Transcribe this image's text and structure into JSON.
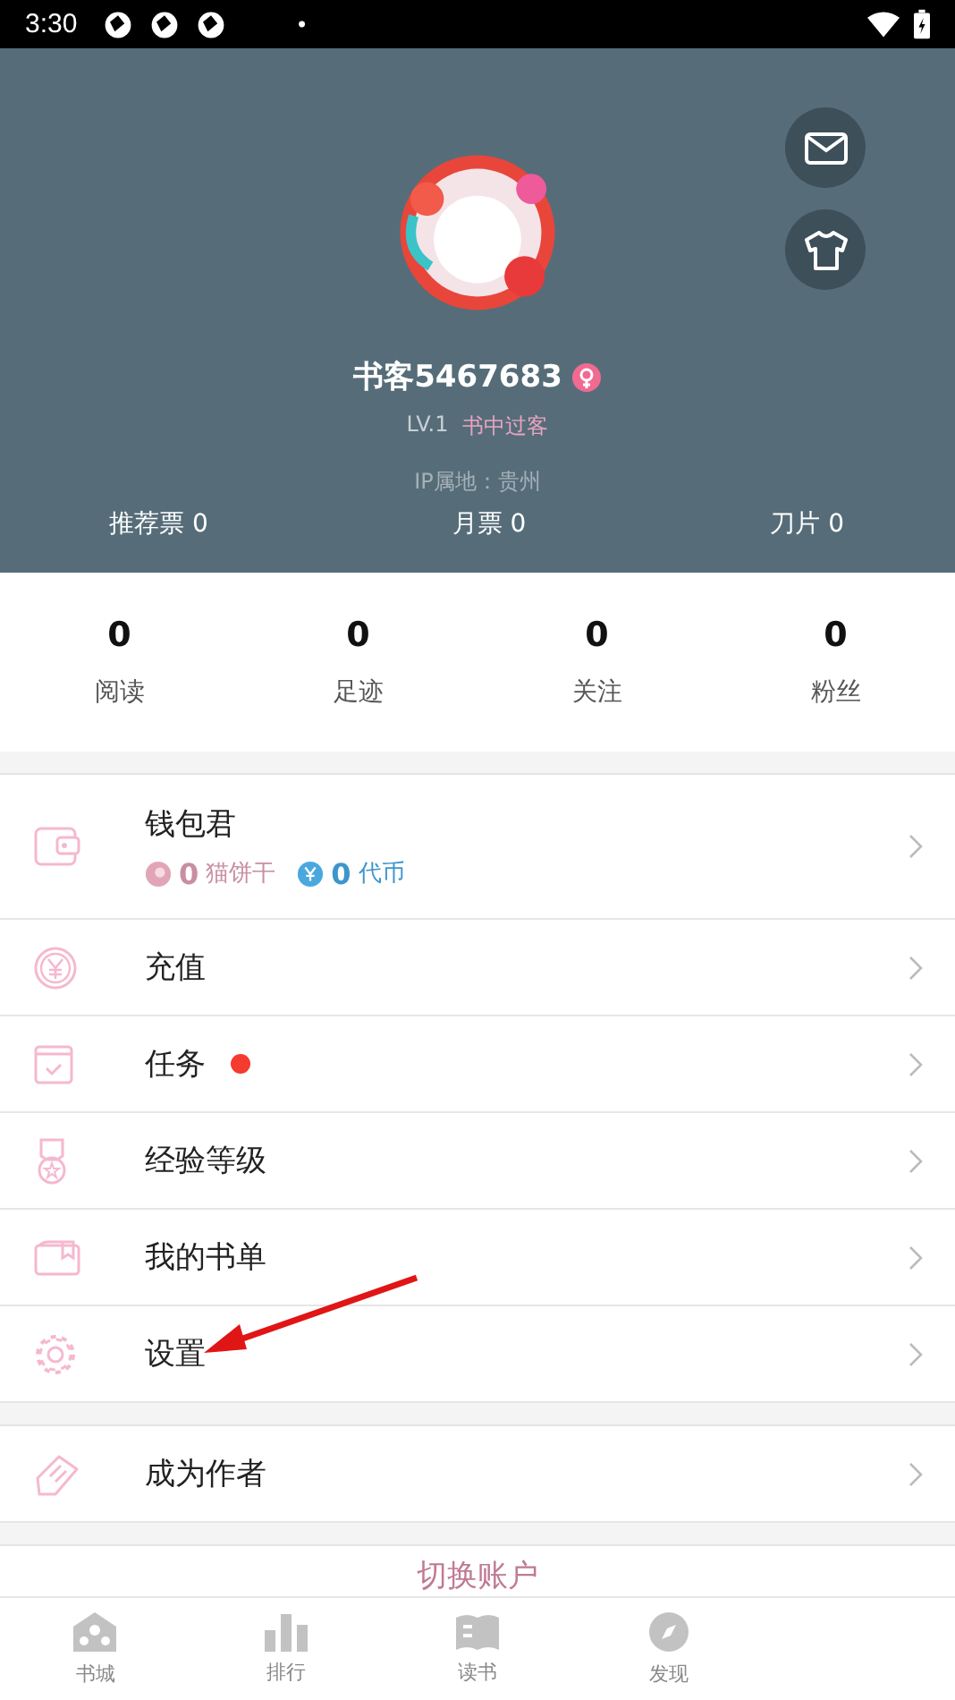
{
  "status_bar": {
    "time": "3:30",
    "dot": "•"
  },
  "profile": {
    "name": "书客5467683",
    "female": true,
    "level": "LV.1",
    "rank_title": "书中过客",
    "ip_location": "IP属地：贵州"
  },
  "header_stats": [
    {
      "label": "推荐票",
      "value": "0"
    },
    {
      "label": "月票",
      "value": "0"
    },
    {
      "label": "刀片",
      "value": "0"
    }
  ],
  "counters": [
    {
      "value": "0",
      "label": "阅读"
    },
    {
      "value": "0",
      "label": "足迹"
    },
    {
      "value": "0",
      "label": "关注"
    },
    {
      "value": "0",
      "label": "粉丝"
    }
  ],
  "menu_groups": [
    [
      {
        "kind": "wallet",
        "label": "钱包君",
        "badge": false,
        "balances": [
          {
            "kind": "cookie",
            "amount": "0",
            "unit": "猫饼干"
          },
          {
            "kind": "coin",
            "amount": "0",
            "unit": "代币"
          }
        ]
      },
      {
        "kind": "recharge",
        "label": "充值",
        "badge": false
      },
      {
        "kind": "task",
        "label": "任务",
        "badge": true
      },
      {
        "kind": "level",
        "label": "经验等级",
        "badge": false
      },
      {
        "kind": "booklist",
        "label": "我的书单",
        "badge": false
      },
      {
        "kind": "settings",
        "label": "设置",
        "badge": false
      }
    ],
    [
      {
        "kind": "author",
        "label": "成为作者",
        "badge": false
      }
    ]
  ],
  "switch_account": "切换账户",
  "bottom_nav": [
    {
      "kind": "store",
      "label": "书城",
      "selected": false
    },
    {
      "kind": "rank",
      "label": "排行",
      "selected": false
    },
    {
      "kind": "read",
      "label": "读书",
      "selected": false
    },
    {
      "kind": "discover",
      "label": "发现",
      "selected": false
    }
  ]
}
